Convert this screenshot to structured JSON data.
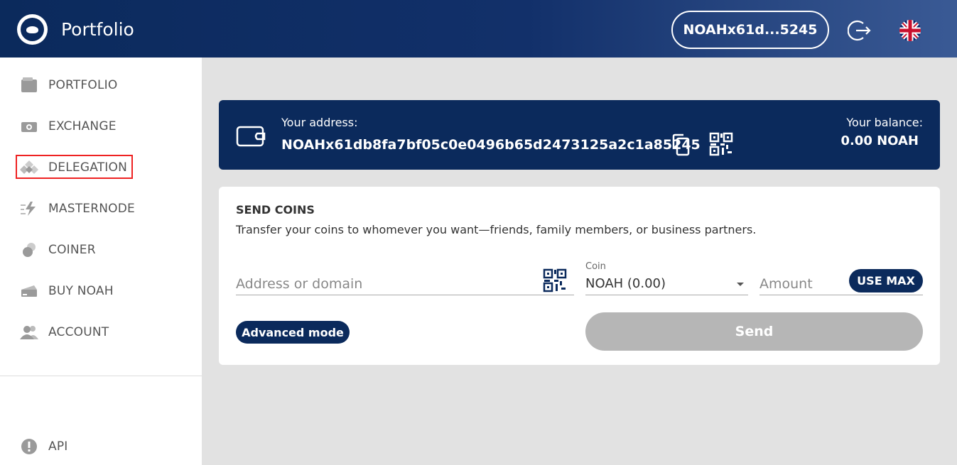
{
  "header": {
    "title": "Portfolio",
    "address_short": "NOAHx61d...5245",
    "logout_icon": "logout-icon",
    "language_icon": "uk-flag-icon"
  },
  "sidebar": {
    "items": [
      {
        "label": "PORTFOLIO",
        "icon": "wallet-icon"
      },
      {
        "label": "EXCHANGE",
        "icon": "exchange-icon"
      },
      {
        "label": "DELEGATION",
        "icon": "delegation-icon"
      },
      {
        "label": "MASTERNODE",
        "icon": "masternode-icon"
      },
      {
        "label": "COINER",
        "icon": "coiner-icon"
      },
      {
        "label": "BUY NOAH",
        "icon": "card-icon"
      },
      {
        "label": "ACCOUNT",
        "icon": "users-icon"
      }
    ],
    "footer_item": {
      "label": "API",
      "icon": "info-icon"
    }
  },
  "address_card": {
    "address_label": "Your address:",
    "address": "NOAHx61db8fa7bf05c0e0496b65d2473125a2c1a85245",
    "balance_label": "Your balance:",
    "balance": "0.00 NOAH"
  },
  "send": {
    "title": "SEND COINS",
    "subtitle": "Transfer your coins to whomever you want—friends, family members, or business partners.",
    "address_placeholder": "Address or domain",
    "coin_label": "Coin",
    "coin_value": "NOAH (0.00)",
    "amount_placeholder": "Amount",
    "use_max_label": "USE MAX",
    "advanced_label": "Advanced mode",
    "send_label": "Send"
  },
  "colors": {
    "primary": "#0b2a5c",
    "disabled": "#b6b6b6",
    "highlight": "#e22222"
  }
}
